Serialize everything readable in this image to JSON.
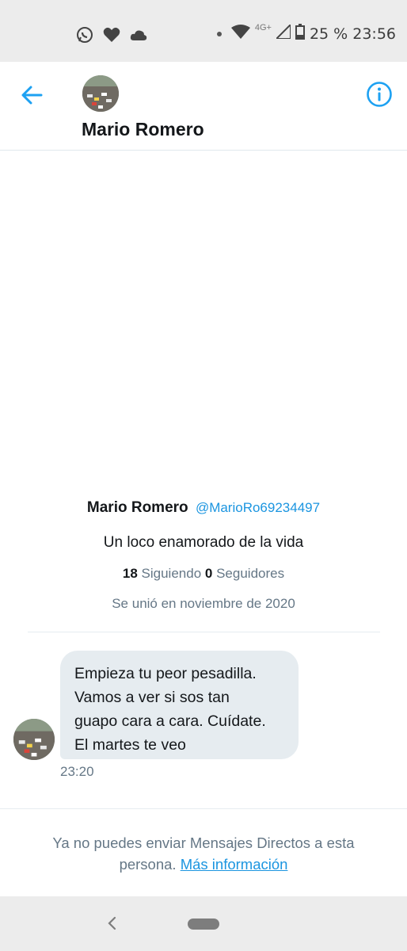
{
  "status_bar": {
    "icons": [
      "whatsapp-icon",
      "heart-icon",
      "cloud-icon",
      "dot-icon",
      "wifi-icon",
      "signal-icon",
      "battery-icon"
    ],
    "network": "4G+",
    "battery": "25 %",
    "time": "23:56"
  },
  "header": {
    "title": "Mario Romero",
    "accent_color": "#1da1f2"
  },
  "profile": {
    "name": "Mario Romero",
    "handle": "@MarioRo69234497",
    "bio": "Un loco enamorado de la vida",
    "following_count": "18",
    "following_label": "Siguiendo",
    "followers_count": "0",
    "followers_label": "Seguidores",
    "joined": "Se unió en noviembre de 2020"
  },
  "message": {
    "lines": [
      "Empieza tu peor pesadilla.",
      "Vamos a ver si sos tan",
      "guapo cara a cara. Cuídate.",
      "El martes te veo"
    ],
    "time": "23:20"
  },
  "notice": {
    "line1": "Ya no puedes enviar Mensajes Directos a esta",
    "line2_prefix": "persona.",
    "link": "Más información"
  }
}
